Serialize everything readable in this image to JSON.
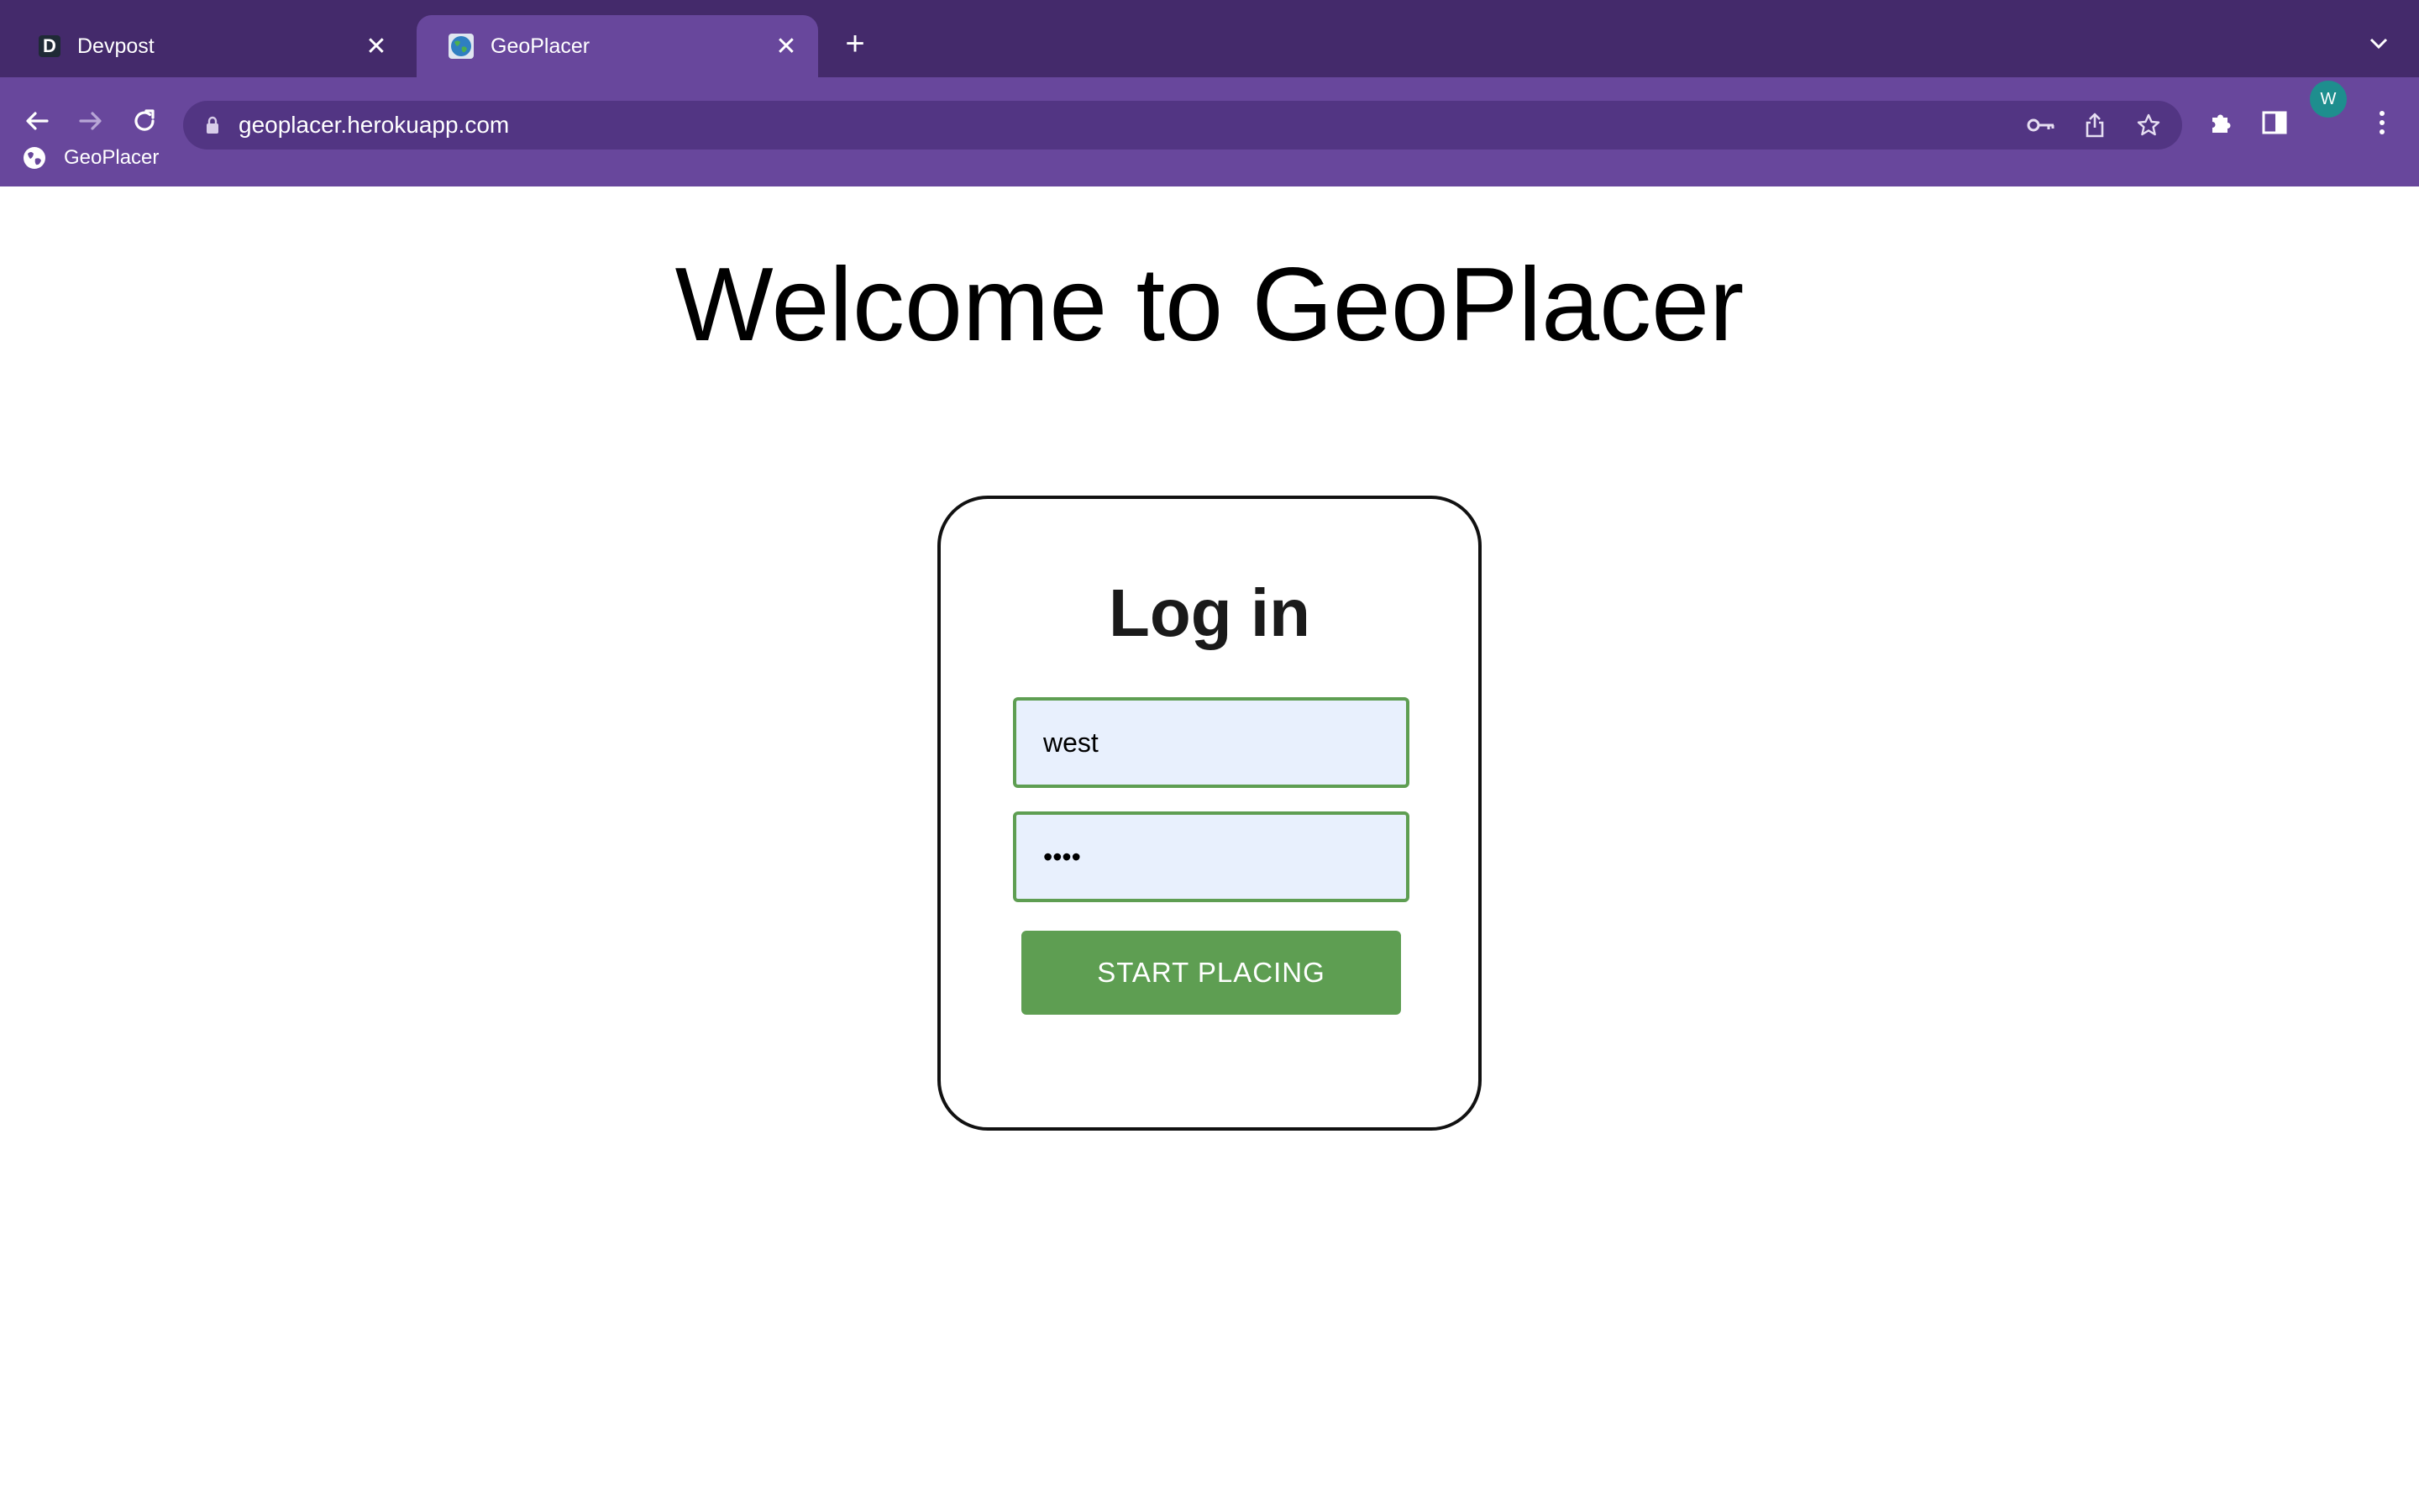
{
  "browser": {
    "tabs": [
      {
        "title": "Devpost",
        "favicon": "devpost-d-icon",
        "active": false
      },
      {
        "title": "GeoPlacer",
        "favicon": "globe-icon",
        "active": true
      }
    ],
    "favicon_letter": "D",
    "close_glyph": "✕",
    "new_tab_glyph": "+",
    "address": "geoplacer.herokuapp.com",
    "avatar_letter": "W",
    "avatar_color": "#1e8e8e",
    "bookmarks": [
      {
        "label": "GeoPlacer",
        "icon": "globe-icon"
      }
    ],
    "theme_colors": {
      "tabstrip": "#442a6b",
      "toolbar": "#68479c"
    }
  },
  "page": {
    "heading": "Welcome to GeoPlacer",
    "login": {
      "title": "Log in",
      "username_value": "west",
      "password_value": "••••",
      "submit_label": "START PLACING"
    },
    "accent_color": "#5e9e52",
    "input_bg": "#e8f0fd"
  }
}
